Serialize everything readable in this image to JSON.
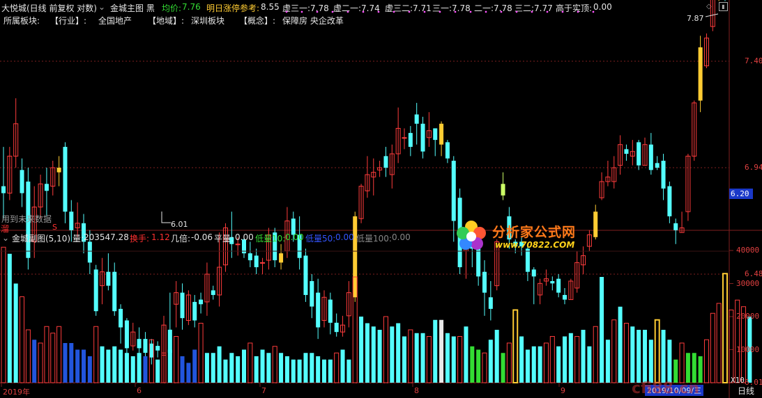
{
  "header": {
    "stock": "大悦城(日线 前复权 对数)",
    "indicator": "金城主图 黑",
    "avg_label": "均价:",
    "avg_value": "7.76",
    "tomorrow_label": "明日涨停参考:",
    "tomorrow_value": "8.55",
    "virtual": [
      {
        "label": "虚三一:",
        "value": "7.78"
      },
      {
        "label": "虚二一:",
        "value": "7.74"
      },
      {
        "label": "虚三二:",
        "value": "7.71"
      },
      {
        "label": "三一:",
        "value": "7.78"
      },
      {
        "label": "二一:",
        "value": "7.78"
      },
      {
        "label": "三二:",
        "value": "7.77"
      }
    ],
    "above_label": "高于实顶:",
    "above_value": "0.00"
  },
  "sector": {
    "label": "所属板块:",
    "industry_label": "【行业】:",
    "industry": "全国地产",
    "region_label": "【地域】:",
    "region": "深圳板块",
    "concept_label": "【概念】:",
    "concept": "保障房 央企改革"
  },
  "price_axis": {
    "ticks": [
      "7.40",
      "6.94",
      "6.48",
      "6.01"
    ],
    "current": "6.20"
  },
  "annotations": {
    "high": "7.87",
    "low": "6.01",
    "future_note": "用到未来数据",
    "mark_left": "溜",
    "mark_s": "S"
  },
  "sub": {
    "title": "金城副图(5,10)",
    "vol_label": "量:",
    "vol_value": "203547.28",
    "turn_label": "换手:",
    "turn_value": "1.12",
    "ratio_label": "几倍:",
    "ratio_value": "-0.06",
    "flat_label": "平量:",
    "flat_value": "0.00",
    "low10_label": "低量10:",
    "low10_value": "0.00",
    "low50_label": "低量50:",
    "low50_value": "0.00",
    "low100_label": "低量100:",
    "low100_value": "0.00"
  },
  "volume_axis": {
    "ticks": [
      "40000",
      "30000",
      "20000",
      "10000"
    ],
    "unit": "X10"
  },
  "xaxis": {
    "labels": [
      "2019年",
      "6",
      "7",
      "8",
      "9"
    ],
    "date_box": "2019/10/09/三",
    "period": "日线"
  },
  "logo": {
    "title": "分析家公式网",
    "url": "www.70822.COM"
  },
  "watermark": "cfi88.cn",
  "colors": {
    "up": "#ff3c3c",
    "down": "#54ffff",
    "gold": "#ffcc33",
    "green": "#33dd33",
    "grid": "#802020"
  },
  "chart_data": {
    "type": "candlestick",
    "price_ticks": [
      7.4,
      6.94,
      6.48,
      6.01
    ],
    "candles": [
      [
        6.86,
        6.83,
        7.03,
        6.72
      ],
      [
        6.83,
        6.99,
        7.03,
        6.8
      ],
      [
        6.99,
        7.13,
        7.24,
        6.94
      ],
      [
        6.93,
        6.83,
        6.98,
        6.77
      ],
      [
        6.88,
        6.55,
        6.94,
        6.5
      ],
      [
        6.62,
        6.77,
        6.86,
        6.55
      ],
      [
        6.77,
        6.87,
        6.91,
        6.72
      ],
      [
        6.87,
        6.84,
        6.94,
        6.73
      ],
      [
        6.86,
        6.94,
        6.97,
        6.82
      ],
      [
        6.92,
        6.94,
        6.99,
        6.86
      ],
      [
        7.03,
        6.75,
        7.05,
        6.7
      ],
      [
        6.75,
        6.67,
        6.8,
        6.62
      ],
      [
        6.68,
        6.7,
        6.79,
        6.64
      ],
      [
        6.7,
        6.62,
        6.74,
        6.57
      ],
      [
        6.62,
        6.53,
        6.67,
        6.48
      ],
      [
        6.5,
        6.32,
        6.52,
        6.3
      ],
      [
        6.43,
        6.49,
        6.55,
        6.35
      ],
      [
        6.49,
        6.43,
        6.57,
        6.41
      ],
      [
        6.49,
        6.32,
        6.53,
        6.3
      ],
      [
        6.33,
        6.25,
        6.35,
        6.18
      ],
      [
        6.28,
        6.16,
        6.29,
        6.13
      ],
      [
        6.17,
        6.23,
        6.27,
        6.15
      ],
      [
        6.2,
        6.16,
        6.25,
        6.13
      ],
      [
        6.2,
        6.14,
        6.23,
        6.11
      ],
      [
        6.18,
        6.12,
        6.2,
        6.09
      ],
      [
        6.17,
        6.15,
        6.19,
        6.12
      ],
      [
        6.13,
        6.26,
        6.3,
        6.01
      ],
      [
        6.24,
        6.14,
        6.4,
        6.12
      ],
      [
        6.35,
        6.4,
        6.45,
        6.25
      ],
      [
        6.4,
        6.29,
        6.44,
        6.24
      ],
      [
        6.28,
        6.39,
        6.41,
        6.26
      ],
      [
        6.36,
        6.28,
        6.39,
        6.25
      ],
      [
        6.37,
        6.35,
        6.4,
        6.31
      ],
      [
        6.36,
        6.48,
        6.53,
        6.3
      ],
      [
        6.41,
        6.39,
        6.43,
        6.37
      ],
      [
        6.39,
        6.51,
        6.66,
        6.34
      ],
      [
        6.52,
        6.68,
        6.7,
        6.49
      ],
      [
        6.64,
        6.61,
        6.75,
        6.55
      ],
      [
        6.61,
        6.61,
        6.64,
        6.56
      ],
      [
        6.63,
        6.57,
        6.65,
        6.55
      ],
      [
        6.57,
        6.54,
        6.62,
        6.51
      ],
      [
        6.56,
        6.51,
        6.59,
        6.48
      ],
      [
        6.53,
        6.53,
        6.55,
        6.48
      ],
      [
        6.54,
        6.65,
        6.68,
        6.5
      ],
      [
        6.66,
        6.54,
        6.68,
        6.51
      ],
      [
        6.53,
        6.57,
        6.61,
        6.5
      ],
      [
        6.58,
        6.71,
        6.77,
        6.55
      ],
      [
        6.72,
        6.65,
        6.75,
        6.62
      ],
      [
        6.65,
        6.55,
        6.73,
        6.5
      ],
      [
        6.56,
        6.39,
        6.59,
        6.36
      ],
      [
        6.45,
        6.34,
        6.48,
        6.29
      ],
      [
        6.4,
        6.25,
        6.46,
        6.2
      ],
      [
        6.28,
        6.38,
        6.41,
        6.25
      ],
      [
        6.37,
        6.27,
        6.4,
        6.22
      ],
      [
        6.27,
        6.23,
        6.31,
        6.21
      ],
      [
        6.23,
        6.26,
        6.3,
        6.21
      ],
      [
        6.3,
        6.4,
        6.45,
        6.25
      ],
      [
        6.38,
        6.73,
        6.75,
        6.36
      ],
      [
        6.72,
        6.86,
        6.87,
        6.7
      ],
      [
        6.84,
        6.91,
        6.99,
        6.81
      ],
      [
        6.9,
        6.92,
        6.98,
        6.82
      ],
      [
        6.93,
        6.94,
        6.97,
        6.9
      ],
      [
        6.99,
        6.94,
        7.03,
        6.9
      ],
      [
        6.91,
        7.0,
        7.04,
        6.85
      ],
      [
        7.0,
        7.11,
        7.2,
        6.96
      ],
      [
        7.07,
        7.07,
        7.11,
        7.02
      ],
      [
        7.09,
        7.03,
        7.12,
        6.99
      ],
      [
        7.17,
        7.13,
        7.22,
        7.04
      ],
      [
        7.13,
        7.01,
        7.16,
        6.98
      ],
      [
        7.07,
        7.1,
        7.18,
        7.03
      ],
      [
        7.11,
        7.06,
        7.11,
        6.99
      ],
      [
        7.13,
        7.04,
        7.14,
        6.99
      ],
      [
        7.05,
        6.98,
        7.06,
        6.96
      ],
      [
        6.97,
        6.71,
        6.99,
        6.62
      ],
      [
        6.81,
        6.51,
        6.85,
        6.48
      ],
      [
        6.58,
        6.61,
        6.68,
        6.46
      ],
      [
        6.63,
        6.59,
        6.67,
        6.51
      ],
      [
        6.59,
        6.47,
        6.62,
        6.43
      ],
      [
        6.49,
        6.4,
        6.54,
        6.3
      ],
      [
        6.38,
        6.33,
        6.45,
        6.28
      ],
      [
        6.43,
        6.62,
        6.63,
        6.41
      ],
      [
        6.87,
        6.82,
        6.92,
        6.8
      ],
      [
        6.73,
        6.63,
        6.77,
        6.59
      ],
      [
        6.62,
        6.6,
        6.63,
        6.57
      ],
      [
        6.62,
        6.6,
        6.64,
        6.56
      ],
      [
        6.59,
        6.49,
        6.61,
        6.45
      ],
      [
        6.5,
        6.47,
        6.51,
        6.35
      ],
      [
        6.39,
        6.44,
        6.46,
        6.35
      ],
      [
        6.45,
        6.46,
        6.5,
        6.43
      ],
      [
        6.45,
        6.44,
        6.47,
        6.41
      ],
      [
        6.46,
        6.4,
        6.48,
        6.38
      ],
      [
        6.39,
        6.37,
        6.42,
        6.35
      ],
      [
        6.37,
        6.45,
        6.46,
        6.37
      ],
      [
        6.42,
        6.53,
        6.58,
        6.4
      ],
      [
        6.52,
        6.56,
        6.6,
        6.48
      ],
      [
        6.6,
        6.65,
        6.67,
        6.58
      ],
      [
        6.64,
        6.75,
        6.78,
        6.63
      ],
      [
        6.81,
        6.88,
        6.92,
        6.8
      ],
      [
        6.88,
        6.9,
        6.97,
        6.86
      ],
      [
        6.88,
        6.94,
        6.99,
        6.85
      ],
      [
        6.95,
        7.04,
        7.08,
        6.91
      ],
      [
        7.02,
        7.0,
        7.04,
        6.97
      ],
      [
        6.99,
        7.01,
        7.06,
        6.95
      ],
      [
        7.05,
        6.95,
        7.06,
        6.93
      ],
      [
        6.95,
        7.04,
        7.07,
        6.95
      ],
      [
        7.04,
        6.93,
        7.09,
        6.91
      ],
      [
        6.96,
        6.94,
        6.99,
        6.93
      ],
      [
        6.97,
        6.85,
        7.0,
        6.8
      ],
      [
        6.86,
        6.73,
        6.88,
        6.7
      ],
      [
        6.7,
        6.67,
        6.72,
        6.61
      ],
      [
        6.66,
        6.68,
        6.75,
        6.66
      ],
      [
        6.75,
        6.99,
        7.0,
        6.71
      ],
      [
        6.99,
        7.22,
        7.23,
        6.97
      ],
      [
        7.23,
        7.46,
        7.51,
        7.18
      ],
      [
        7.38,
        7.5,
        7.52,
        7.37
      ],
      [
        7.55,
        7.72,
        7.78,
        7.53
      ],
      [
        7.67,
        7.79,
        7.87,
        7.66
      ],
      [
        7.79,
        7.76,
        7.85,
        7.66
      ]
    ],
    "volume_ticks": [
      40000,
      30000,
      20000,
      10000
    ],
    "volume": [
      [
        42000,
        "u"
      ],
      [
        39000,
        "d"
      ],
      [
        30000,
        "d"
      ],
      [
        26000,
        "u"
      ],
      [
        16000,
        "u"
      ],
      [
        13000,
        "D"
      ],
      [
        12000,
        "u"
      ],
      [
        17000,
        "u"
      ],
      [
        15000,
        "u"
      ],
      [
        17000,
        "u"
      ],
      [
        12000,
        "D"
      ],
      [
        12000,
        "D"
      ],
      [
        10000,
        "D"
      ],
      [
        10000,
        "D"
      ],
      [
        8000,
        "D"
      ],
      [
        17000,
        "u"
      ],
      [
        11000,
        "d"
      ],
      [
        10000,
        "d"
      ],
      [
        11000,
        "d"
      ],
      [
        10000,
        "d"
      ],
      [
        9000,
        "d"
      ],
      [
        8000,
        "d"
      ],
      [
        9000,
        "d"
      ],
      [
        8000,
        "D"
      ],
      [
        13000,
        "u"
      ],
      [
        7000,
        "d"
      ],
      [
        9000,
        "u"
      ],
      [
        10000,
        "d"
      ],
      [
        14000,
        "u"
      ],
      [
        8000,
        "D"
      ],
      [
        6000,
        "D"
      ],
      [
        10000,
        "D"
      ],
      [
        18000,
        "u"
      ],
      [
        9000,
        "d"
      ],
      [
        9000,
        "d"
      ],
      [
        11000,
        "d"
      ],
      [
        7000,
        "d"
      ],
      [
        9000,
        "d"
      ],
      [
        8000,
        "d"
      ],
      [
        10000,
        "d"
      ],
      [
        12000,
        "u"
      ],
      [
        8000,
        "d"
      ],
      [
        10000,
        "d"
      ],
      [
        9000,
        "d"
      ],
      [
        11000,
        "u"
      ],
      [
        9000,
        "d"
      ],
      [
        8000,
        "d"
      ],
      [
        7000,
        "d"
      ],
      [
        7000,
        "d"
      ],
      [
        9000,
        "d"
      ],
      [
        9000,
        "d"
      ],
      [
        8000,
        "d"
      ],
      [
        7000,
        "d"
      ],
      [
        7000,
        "d"
      ],
      [
        9000,
        "u"
      ],
      [
        10000,
        "d"
      ],
      [
        7000,
        "d"
      ],
      [
        32000,
        "u"
      ],
      [
        20000,
        "d"
      ],
      [
        18000,
        "d"
      ],
      [
        17000,
        "d"
      ],
      [
        16000,
        "d"
      ],
      [
        20000,
        "u"
      ],
      [
        17000,
        "d"
      ],
      [
        18000,
        "d"
      ],
      [
        14000,
        "d"
      ],
      [
        16000,
        "u"
      ],
      [
        15000,
        "d"
      ],
      [
        15000,
        "d"
      ],
      [
        14000,
        "u"
      ],
      [
        19000,
        "d"
      ],
      [
        19000,
        "w"
      ],
      [
        15000,
        "d"
      ],
      [
        14000,
        "d"
      ],
      [
        14000,
        "u"
      ],
      [
        17000,
        "d"
      ],
      [
        11000,
        "g"
      ],
      [
        10000,
        "g"
      ],
      [
        9000,
        "u"
      ],
      [
        13000,
        "d"
      ],
      [
        16000,
        "d"
      ],
      [
        9000,
        "g"
      ],
      [
        12000,
        "u"
      ],
      [
        22000,
        "y"
      ],
      [
        14000,
        "d"
      ],
      [
        10000,
        "d"
      ],
      [
        11000,
        "d"
      ],
      [
        11000,
        "d"
      ],
      [
        12000,
        "u"
      ],
      [
        14000,
        "u"
      ],
      [
        11000,
        "d"
      ],
      [
        14000,
        "d"
      ],
      [
        15000,
        "d"
      ],
      [
        14000,
        "u"
      ],
      [
        16000,
        "d"
      ],
      [
        11000,
        "d"
      ],
      [
        17000,
        "u"
      ],
      [
        32000,
        "d"
      ],
      [
        13000,
        "d"
      ],
      [
        19000,
        "u"
      ],
      [
        23000,
        "d"
      ],
      [
        18000,
        "u"
      ],
      [
        17000,
        "d"
      ],
      [
        16000,
        "d"
      ],
      [
        16000,
        "d"
      ],
      [
        13000,
        "d"
      ],
      [
        19000,
        "y"
      ],
      [
        16000,
        "d"
      ],
      [
        13000,
        "d"
      ],
      [
        7000,
        "g"
      ],
      [
        12000,
        "u"
      ],
      [
        9000,
        "g"
      ],
      [
        9000,
        "g"
      ],
      [
        8000,
        "g"
      ],
      [
        13000,
        "u"
      ],
      [
        21000,
        "u"
      ],
      [
        24000,
        "u"
      ],
      [
        33000,
        "y"
      ],
      [
        22000,
        "u"
      ],
      [
        25000,
        "u"
      ],
      [
        23000,
        "u"
      ],
      [
        20000,
        "d"
      ]
    ]
  }
}
